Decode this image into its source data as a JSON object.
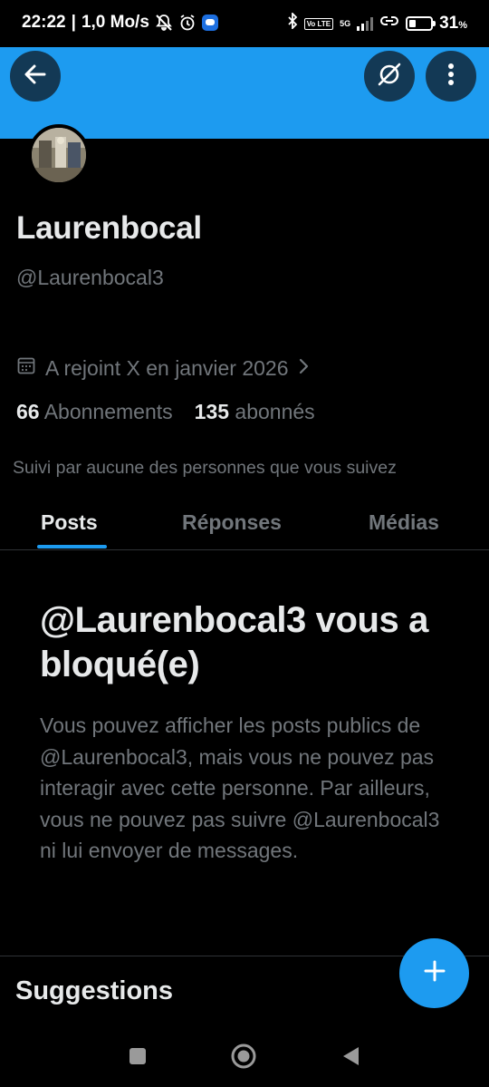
{
  "status_bar": {
    "time": "22:22",
    "speed": "1,0 Mo/s",
    "volte": "Vo LTE",
    "network": "5G",
    "battery": "31",
    "battery_unit": "%",
    "battery_level": 0.31
  },
  "header": {
    "back_icon": "arrow-left-icon",
    "grok_icon": "grok-icon",
    "more_icon": "vertical-dots-icon",
    "banner_color": "#1d9bf0"
  },
  "profile": {
    "display_name": "Laurenbocal",
    "handle": "@Laurenbocal3",
    "joined": "A rejoint X en janvier 2026",
    "following_count": "66",
    "following_label": "Abonnements",
    "followers_count": "135",
    "followers_label": "abonnés",
    "followed_by": "Suivi par aucune des personnes que vous suivez"
  },
  "tabs": [
    {
      "label": "Posts",
      "active": true
    },
    {
      "label": "Réponses",
      "active": false
    },
    {
      "label": "Médias",
      "active": false
    }
  ],
  "blocked": {
    "title": "@Laurenbocal3 vous a bloqué(e)",
    "body": "Vous pouvez afficher les posts publics de @Laurenbocal3, mais vous ne pouvez pas interagir avec cette personne. Par ailleurs, vous ne pouvez pas suivre @Laurenbocal3 ni lui envoyer de messages."
  },
  "suggestions": {
    "title": "Suggestions"
  },
  "fab": {
    "icon": "plus-icon"
  },
  "colors": {
    "accent": "#1d9bf0",
    "background": "#000000",
    "text_primary": "#e7e9ea",
    "text_secondary": "#71767b"
  }
}
